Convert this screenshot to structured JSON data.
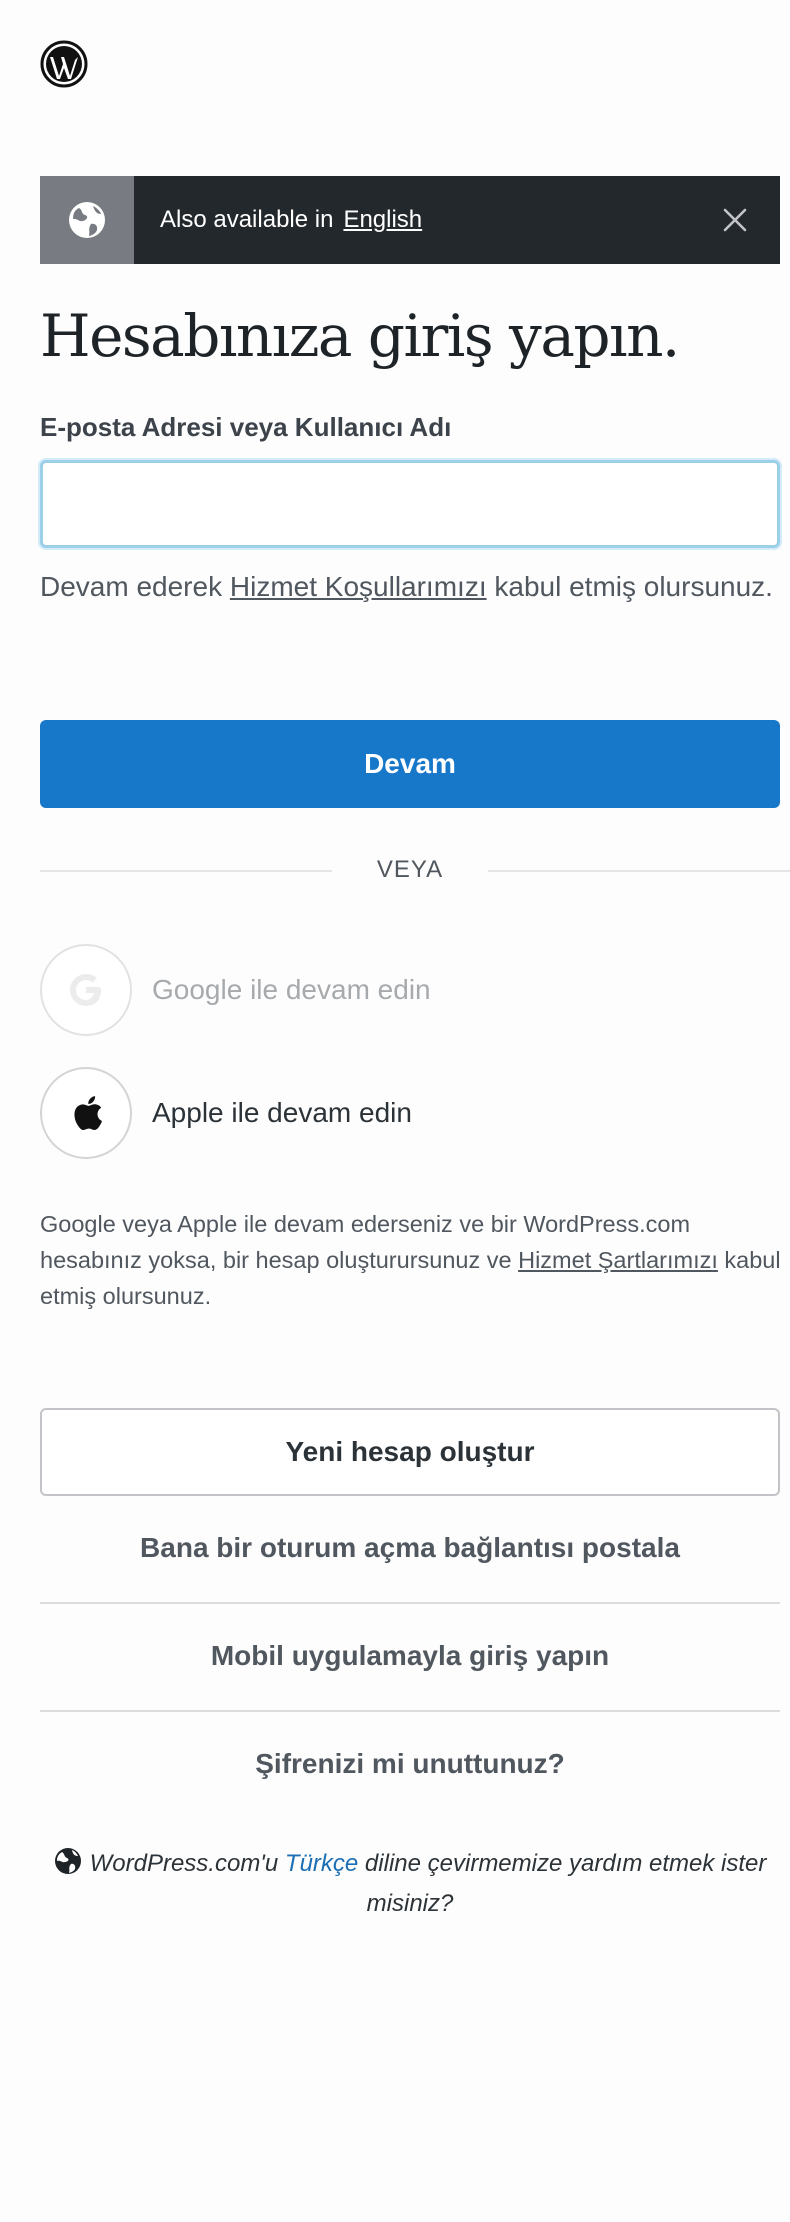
{
  "logo": {
    "icon": "wordpress-logo-icon"
  },
  "notice": {
    "prefix": "Also available in",
    "link": "English",
    "globe_icon": "globe-icon",
    "close_icon": "close-icon"
  },
  "heading": "Hesabınıza giriş yapın.",
  "email": {
    "label": "E-posta Adresi veya Kullanıcı Adı",
    "value": ""
  },
  "terms_main": {
    "before": "Devam ederek ",
    "link": "Hizmet Koşullarımızı",
    "after": " kabul etmiş olursunuz."
  },
  "continue_label": "Devam",
  "or_label": "VEYA",
  "social": {
    "google": "Google ile devam edin",
    "apple": "Apple ile devam edin"
  },
  "terms_social": {
    "before": "Google veya Apple ile devam ederseniz ve bir WordPress.com hesabınız yoksa, bir hesap oluşturursunuz ve ",
    "link": "Hizmet Şartlarımızı",
    "after": " kabul etmiş olursunuz."
  },
  "create_account": "Yeni hesap oluştur",
  "magic_link": "Bana bir oturum açma bağlantısı postala",
  "mobile_login": "Mobil uygulamayla giriş yapın",
  "forgot_password": "Şifrenizi mi unuttunuz?",
  "translate": {
    "before": "WordPress.com'u ",
    "language": "Türkçe",
    "after": " diline çevirmemize yardım etmek ister misiniz?"
  },
  "colors": {
    "primary": "#1777c8",
    "notice_bg": "#23282d",
    "link_blue": "#1d6fb5"
  }
}
